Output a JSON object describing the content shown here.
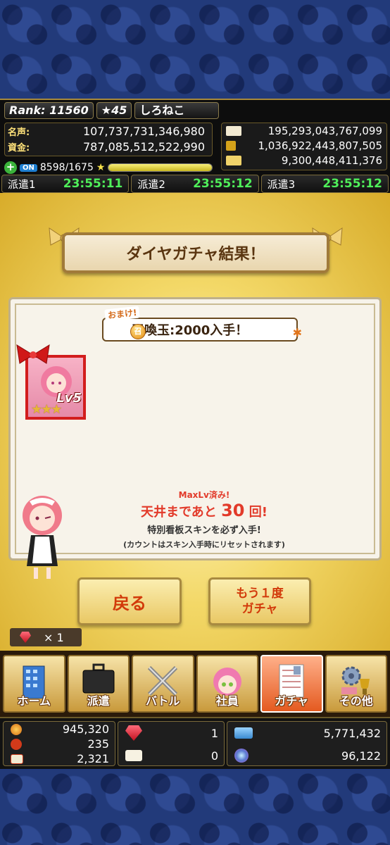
{
  "header": {
    "rank": "Rank: 11560",
    "stars": "★45",
    "player_name": "しろねこ",
    "fame_label": "名声:",
    "fame_value": "107,737,731,346,980",
    "funds_label": "資金:",
    "funds_value": "787,085,512,522,990",
    "res1": "195,293,043,767,099",
    "res2": "1,036,922,443,807,505",
    "res3": "9,300,448,411,376",
    "on_badge": "ON",
    "stamina": "8598/1675",
    "stamina_fill": 1.0,
    "dispatches": [
      {
        "label": "派遣1",
        "time": "23:55:11"
      },
      {
        "label": "派遣2",
        "time": "23:55:12"
      },
      {
        "label": "派遣3",
        "time": "23:55:12"
      }
    ]
  },
  "result": {
    "title": "ダイヤガチャ結果！",
    "bonus_tag": "おまけ!",
    "bonus_coin": "召",
    "bonus_text": "召喚玉:2000入手！",
    "card_level": "Lv5",
    "card_stars": "★★★",
    "maxlv": "MaxLv済み!",
    "ceiling_pre": "天井まであと",
    "ceiling_count": "30",
    "ceiling_post": "回!",
    "skin_line": "特別看板スキンを必ず入手!",
    "reset_line": "(カウントはスキン入手時にリセットされます)",
    "back_button": "戻る",
    "again_line1": "もう１度",
    "again_line2": "ガチャ"
  },
  "gems": {
    "count": "× 1"
  },
  "nav": [
    {
      "label": "ホーム",
      "icon": "building-icon"
    },
    {
      "label": "派遣",
      "icon": "briefcase-icon"
    },
    {
      "label": "バトル",
      "icon": "crossed-swords-icon"
    },
    {
      "label": "社員",
      "icon": "employee-icon"
    },
    {
      "label": "ガチャ",
      "icon": "gacha-document-icon",
      "active": true
    },
    {
      "label": "その他",
      "icon": "gear-trophy-icon"
    }
  ],
  "footer": {
    "coin1": "945,320",
    "coin2": "235",
    "coin3": "2,321",
    "gem_count": "1",
    "ticket_count": "0",
    "ticket2": "5,771,432",
    "orb": "96,122"
  },
  "colors": {
    "accent_green": "#4ff05a",
    "banner_text": "#5a3510",
    "button_text": "#d23a0a",
    "active_tab": "#e45a20",
    "card_border": "#d21d1d"
  }
}
